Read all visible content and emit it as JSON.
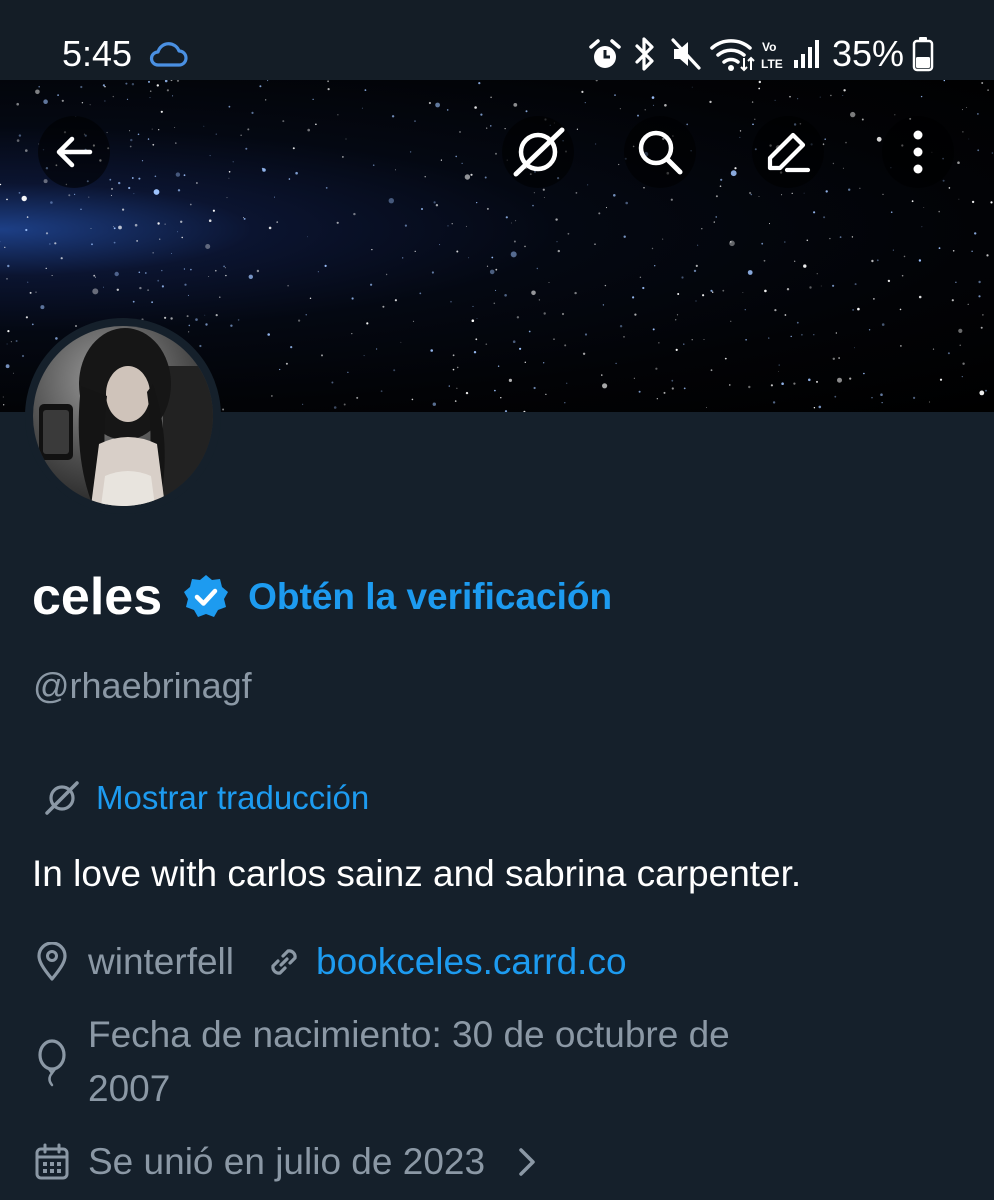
{
  "status_bar": {
    "time": "5:45",
    "battery_percent": "35%",
    "icons": [
      "cloud-icon",
      "alarm-icon",
      "bluetooth-icon",
      "mute-icon",
      "wifi-icon",
      "volte-icon",
      "signal-icon",
      "battery-icon"
    ],
    "volte_top": "Vo",
    "volte_bottom": "LTE"
  },
  "header": {
    "buttons": [
      "back-arrow-icon",
      "grok-icon",
      "search-icon",
      "edit-icon",
      "more-vertical-icon"
    ]
  },
  "profile": {
    "display_name": "celes",
    "verify_cta": "Obtén la verificación",
    "handle": "@rhaebrinagf",
    "translate_label": "Mostrar traducción",
    "bio": "In love with carlos sainz and sabrina carpenter.",
    "location": "winterfell",
    "website": "bookceles.carrd.co",
    "birth_line_1": "Fecha de nacimiento: 30 de octubre de",
    "birth_line_2": "2007",
    "joined": "Se unió en julio de 2023"
  },
  "colors": {
    "background": "#15202b",
    "accent": "#1d9bf0",
    "secondary_text": "#8b98a5",
    "primary_text": "#ffffff"
  }
}
